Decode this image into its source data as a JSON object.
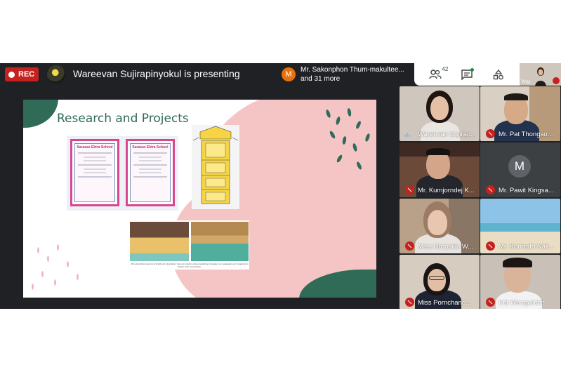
{
  "toolbar": {
    "rec_label": "REC",
    "presenting_text": "Wareevan Sujirapinyokul is presenting",
    "speaker_initial": "M",
    "speaker_name": "Mr. Sakonphon Thum-makultee...",
    "speaker_more": "and 31 more",
    "people_count": "42",
    "self_label": "You"
  },
  "slide": {
    "title": "Research and Projects",
    "cert_school": "Sarasas Ektra School",
    "caption": "The attraction and eco-friendly art of produce that are sold to using marketing strategies on campaign each students to please their own plants."
  },
  "participants": [
    {
      "name": "Wareevan Sujirap...",
      "muted": false
    },
    {
      "name": "Mr. Pat Thongso...",
      "muted": true
    },
    {
      "name": "Mr. Kumjorndej K...",
      "muted": true
    },
    {
      "name": "Mr. Pawit Kingsa...",
      "muted": true,
      "initial": "M"
    },
    {
      "name": "Miss Ornpailin W...",
      "muted": true
    },
    {
      "name": "Mr. Kornrath Nak...",
      "muted": true
    },
    {
      "name": "Miss Pornchano...",
      "muted": true
    },
    {
      "name": "Krit Wangwichit",
      "muted": true
    }
  ],
  "colors": {
    "rec_red": "#c5221f",
    "meet_dark": "#202124",
    "slide_green": "#2f6b57",
    "slide_pink": "#f5c5c6"
  }
}
